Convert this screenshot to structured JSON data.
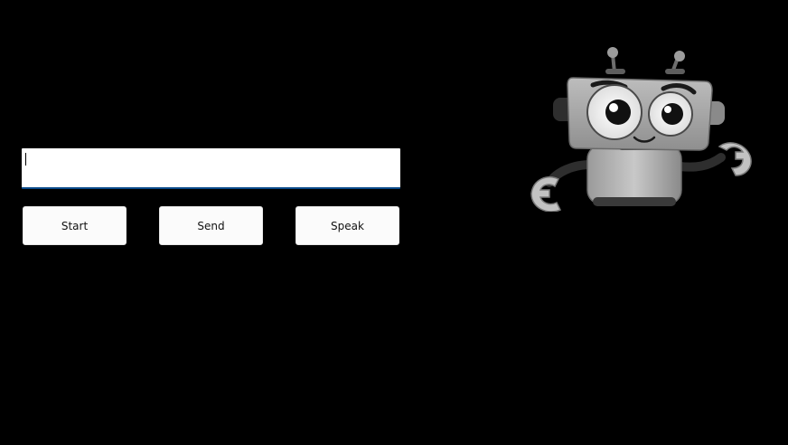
{
  "input": {
    "value": "",
    "placeholder": ""
  },
  "buttons": {
    "start_label": "Start",
    "send_label": "Send",
    "speak_label": "Speak"
  },
  "mascot": {
    "icon": "robot-icon"
  },
  "colors": {
    "background": "#000000",
    "input_focus_border": "#0a4a8a",
    "button_bg": "#fbfbfb"
  }
}
